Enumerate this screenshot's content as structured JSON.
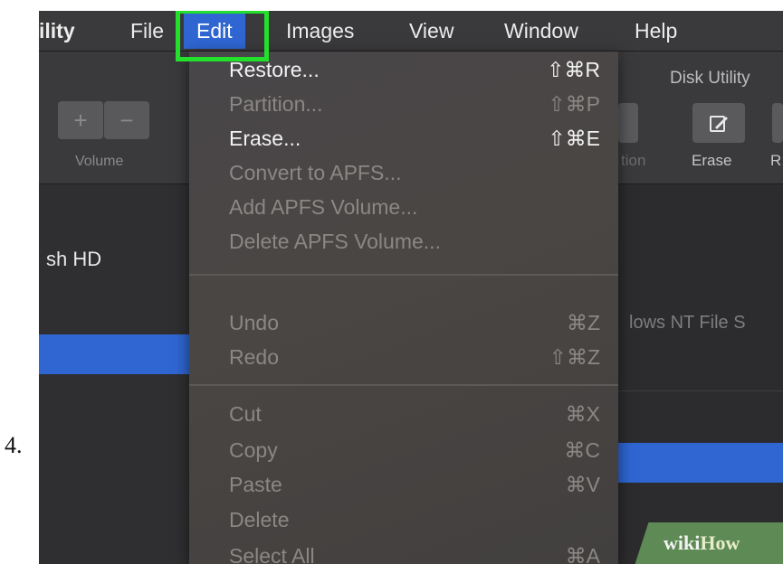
{
  "step": {
    "number": "4."
  },
  "menubar": {
    "app_name": "ility",
    "items": [
      "File",
      "Edit",
      "Images",
      "View",
      "Window",
      "Help"
    ],
    "active": "Edit"
  },
  "left_toolbar": {
    "add_icon": "+",
    "remove_icon": "−",
    "volume_label": "Volume"
  },
  "sidebar": {
    "disk_name": "sh HD"
  },
  "right_window": {
    "title": "Disk Utility",
    "partition_label_partial": "tion",
    "erase_label": "Erase",
    "next_label_partial": "R",
    "info_text": "lows NT File S"
  },
  "edit_menu": {
    "groups": [
      [
        {
          "label": "Restore...",
          "shortcut": "⇧⌘R",
          "enabled": true
        },
        {
          "label": "Partition...",
          "shortcut": "⇧⌘P",
          "enabled": false
        },
        {
          "label": "Erase...",
          "shortcut": "⇧⌘E",
          "enabled": true
        },
        {
          "label": "Convert to APFS...",
          "shortcut": "",
          "enabled": false
        },
        {
          "label": "Add APFS Volume...",
          "shortcut": "",
          "enabled": false
        },
        {
          "label": "Delete APFS Volume...",
          "shortcut": "",
          "enabled": false
        }
      ],
      [
        {
          "label": "Undo",
          "shortcut": "⌘Z",
          "enabled": false
        },
        {
          "label": "Redo",
          "shortcut": "⇧⌘Z",
          "enabled": false
        }
      ],
      [
        {
          "label": "Cut",
          "shortcut": "⌘X",
          "enabled": false
        },
        {
          "label": "Copy",
          "shortcut": "⌘C",
          "enabled": false
        },
        {
          "label": "Paste",
          "shortcut": "⌘V",
          "enabled": false
        },
        {
          "label": "Delete",
          "shortcut": "",
          "enabled": false
        },
        {
          "label": "Select All",
          "shortcut": "⌘A",
          "enabled": false
        }
      ]
    ]
  },
  "watermark": {
    "part1": "wiki",
    "part2": "How"
  },
  "colors": {
    "accent": "#2f66d2",
    "highlight_box": "#22e02c",
    "menu_bg": "#48454a",
    "enabled_text": "#f2f2f2",
    "disabled_text": "#8a8784"
  }
}
